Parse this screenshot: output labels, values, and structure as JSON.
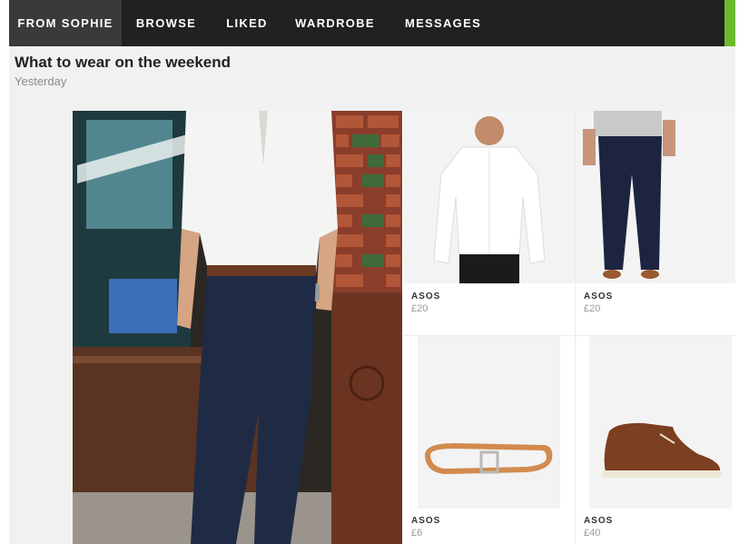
{
  "nav": {
    "tabs": [
      {
        "label": "FROM SOPHIE",
        "active": true
      },
      {
        "label": "BROWSE",
        "active": false
      },
      {
        "label": "LIKED",
        "active": false
      },
      {
        "label": "WARDROBE",
        "active": false
      },
      {
        "label": "MESSAGES",
        "active": false
      }
    ],
    "accent_color": "#6dbb2d"
  },
  "post": {
    "title": "What to wear on the weekend",
    "date": "Yesterday"
  },
  "outfit": {
    "hero_image": "man-in-white-shirt-and-navy-chinos-photo",
    "products": [
      {
        "item": "white-oxford-shirt",
        "brand": "ASOS",
        "price": "£20"
      },
      {
        "item": "navy-chinos",
        "brand": "ASOS",
        "price": "£20"
      },
      {
        "item": "tan-leather-belt",
        "brand": "ASOS",
        "price": "£6"
      },
      {
        "item": "brown-suede-desert-boots",
        "brand": "ASOS",
        "price": "£40"
      }
    ]
  }
}
